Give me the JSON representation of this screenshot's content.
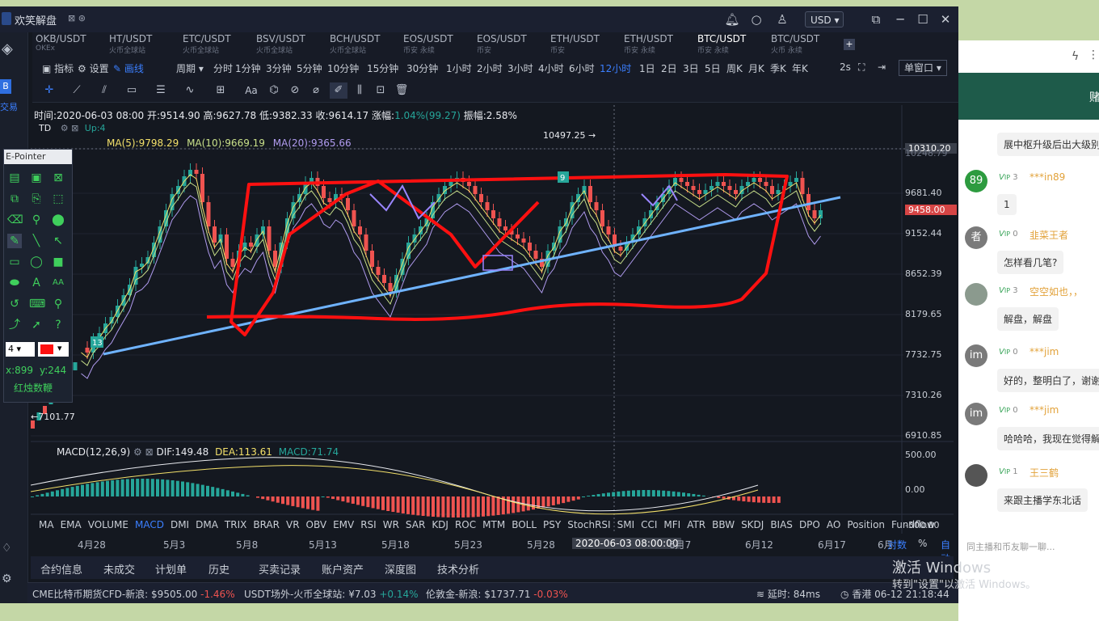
{
  "app": {
    "title": "欢笑解盘",
    "currency": "USD"
  },
  "tabs": [
    {
      "pair": "OKB/USDT",
      "exchange": "OKEx"
    },
    {
      "pair": "HT/USDT",
      "exchange": "火币全球站"
    },
    {
      "pair": "ETC/USDT",
      "exchange": "火币全球站"
    },
    {
      "pair": "BSV/USDT",
      "exchange": "火币全球站"
    },
    {
      "pair": "BCH/USDT",
      "exchange": "火币全球站"
    },
    {
      "pair": "EOS/USDT",
      "exchange": "币安 永续"
    },
    {
      "pair": "EOS/USDT",
      "exchange": "币安"
    },
    {
      "pair": "ETH/USDT",
      "exchange": "币安"
    },
    {
      "pair": "ETH/USDT",
      "exchange": "币安 永续"
    },
    {
      "pair": "BTC/USDT",
      "exchange": "币安 永续"
    },
    {
      "pair": "BTC/USDT",
      "exchange": "火币 永续"
    }
  ],
  "active_tab": 9,
  "toolbar": {
    "indicator": "指标",
    "settings": "设置",
    "draw": "画线",
    "period": "周期",
    "periods": [
      "分时",
      "1分钟",
      "3分钟",
      "5分钟",
      "10分钟",
      "15分钟",
      "30分钟",
      "1小时",
      "2小时",
      "3小时",
      "4小时",
      "6小时",
      "12小时",
      "1日",
      "2日",
      "3日",
      "5日",
      "周K",
      "月K",
      "季K",
      "年K"
    ],
    "active_period": "12小时",
    "interval": "2s",
    "window_mode": "单窗口"
  },
  "ohlc": {
    "time_label": "时间:2020-06-03 08:00",
    "open_label": "开:9514.90",
    "high_label": "高:9627.78",
    "low_label": "低:9382.33",
    "close_label": "收:9614.17",
    "change_label": "涨幅:",
    "change_value": "1.04%(99.27)",
    "amp_label": "振幅:2.58%"
  },
  "td": {
    "name": "TD",
    "up": "Up:4"
  },
  "ma": {
    "ma5": "MA(5):9798.29",
    "ma10": "MA(10):9669.19",
    "ma20": "MA(20):9365.66"
  },
  "price_axis": [
    "10310.20",
    "10248.79",
    "9681.40",
    "9458.00",
    "9152.44",
    "8652.39",
    "8179.65",
    "7732.75",
    "7310.26",
    "6910.85"
  ],
  "current_price": "9458.00",
  "high_marker": "10497.25",
  "low_marker": "7101.77",
  "td_marks": [
    "9",
    "13"
  ],
  "macd": {
    "name": "MACD(12,26,9)",
    "dif": "DIF:149.48",
    "dea": "DEA:113.61",
    "macd": "MACD:71.74",
    "axis": [
      "500.00",
      "0.00",
      "-500.00"
    ]
  },
  "indicators": [
    "MA",
    "EMA",
    "VOLUME",
    "MACD",
    "DMI",
    "DMA",
    "TRIX",
    "BRAR",
    "VR",
    "OBV",
    "EMV",
    "RSI",
    "WR",
    "SAR",
    "KDJ",
    "ROC",
    "MTM",
    "BOLL",
    "PSY",
    "StochRSI",
    "SMI",
    "CCI",
    "MFI",
    "ATR",
    "BBW",
    "SKDJ",
    "BIAS",
    "DPO",
    "AO",
    "Position",
    "Fundflow"
  ],
  "active_indicator": "MACD",
  "dates": [
    "4月28",
    "5月3",
    "5月8",
    "5月13",
    "5月18",
    "5月23",
    "5月28",
    "2020-06-03 08:00:00",
    "6月7",
    "6月12",
    "6月17",
    "6月"
  ],
  "date_options": [
    "对数",
    "%",
    "自动"
  ],
  "bottom_tabs": [
    "合约信息",
    "未成交",
    "计划单",
    "历史",
    "买卖记录",
    "账户资产",
    "深度图",
    "技术分析"
  ],
  "status": {
    "cme_label": "CME比特币期货CFD-新浪:",
    "cme_price": "$9505.00",
    "cme_change": "-1.46%",
    "usdt_label": "USDT场外-火币全球站:",
    "usdt_price": "¥7.03",
    "usdt_change": "+0.14%",
    "gold_label": "伦敦金-新浪:",
    "gold_price": "$1737.71",
    "gold_change": "-0.03%",
    "latency": "延时: 84ms",
    "location_time": "香港 06-12 21:18:44"
  },
  "epointer": {
    "title": "E-Pointer",
    "size": "4",
    "x": "x:899",
    "y": "y:244",
    "label": "红烛数鞭"
  },
  "chat": {
    "header_text": "赌",
    "messages": [
      {
        "avatar": "",
        "name": "",
        "level": "",
        "text": "展中枢升级后出大级别"
      },
      {
        "avatar": "89",
        "name": "***in89",
        "level": "3",
        "text": "1"
      },
      {
        "avatar": "者",
        "name": "韭菜王者",
        "level": "0",
        "text": "怎样看几笔?"
      },
      {
        "avatar": "",
        "name": "空空如也，，",
        "level": "3",
        "text": "解盘，解盘"
      },
      {
        "avatar": "im",
        "name": "***jim",
        "level": "0",
        "text": "好的，整明白了，谢谢"
      },
      {
        "avatar": "im",
        "name": "***jim",
        "level": "0",
        "text": "哈哈哈，我现在觉得解"
      },
      {
        "avatar": "",
        "name": "王三鹤",
        "level": "1",
        "text": "来跟主播学东北话"
      }
    ],
    "input_placeholder": "同主播和币友聊一聊..."
  },
  "watermark": {
    "line1": "激活 Windows",
    "line2": "转到\"设置\"以激活 Windows。"
  },
  "colors": {
    "up": "#26a69a",
    "down": "#ef5350",
    "accent": "#3b7fff",
    "annotation": "#ff1010",
    "trendline": "#6fb3ff"
  }
}
